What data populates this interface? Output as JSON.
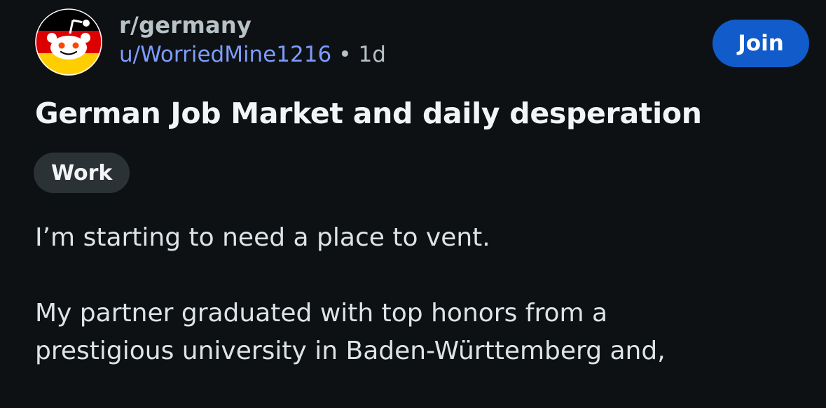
{
  "header": {
    "subreddit": "r/germany",
    "username": "u/WorriedMine1216",
    "separator": "•",
    "age": "1d",
    "join_label": "Join"
  },
  "post": {
    "title": "German Job Market and daily desperation",
    "flair": "Work",
    "paragraphs": [
      "I’m starting to need a place to vent.",
      "My partner graduated with top honors from a\nprestigious university in Baden-Württemberg and,"
    ]
  },
  "icons": {
    "avatar": "snoo-germany-flag-avatar"
  },
  "colors": {
    "background": "#0e1113",
    "join_button": "#115bca",
    "username": "#7d9cff",
    "flair_bg": "#2a3236"
  }
}
